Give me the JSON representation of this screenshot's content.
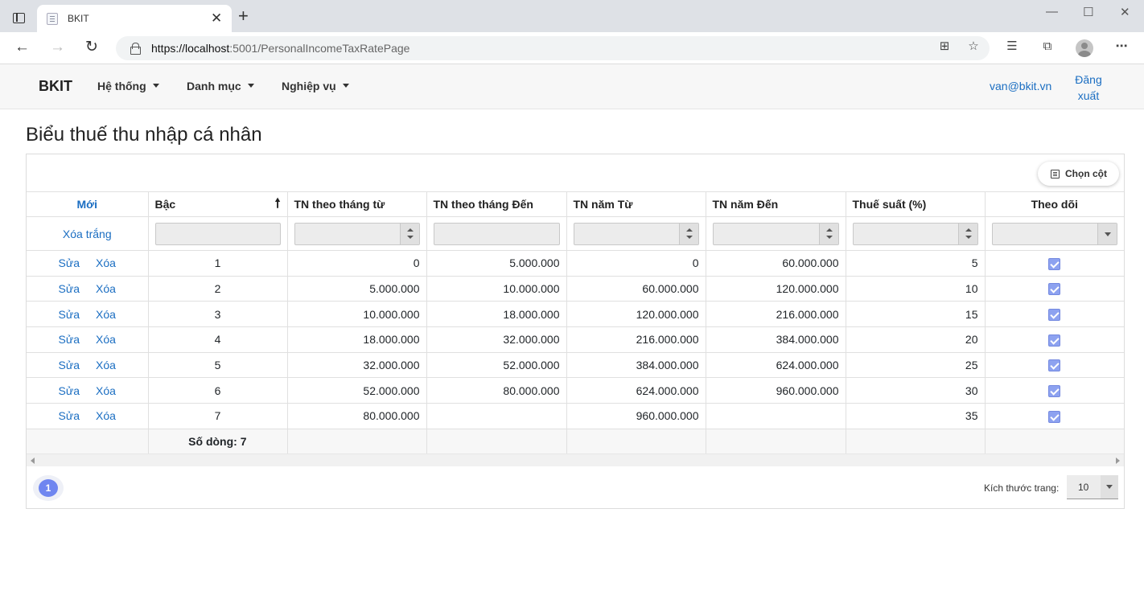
{
  "browser": {
    "tab_title": "BKIT",
    "tab_close": "✕",
    "new_tab": "+",
    "url_host": "https://localhost",
    "url_rest": ":5001/PersonalIncomeTaxRatePage",
    "window_controls": [
      "—",
      "☐",
      "✕"
    ]
  },
  "navbar": {
    "brand": "BKIT",
    "menus": [
      "Hệ thống",
      "Danh mục",
      "Nghiệp vụ"
    ],
    "user": "van@bkit.vn",
    "logout_line1": "Đăng",
    "logout_line2": "xuất"
  },
  "page": {
    "title": "Biểu thuế thu nhập cá nhân"
  },
  "grid": {
    "column_chooser": "Chọn cột",
    "new_label": "Mới",
    "clear_filter": "Xóa trắng",
    "edit_label": "Sửa",
    "delete_label": "Xóa",
    "columns": [
      "Bậc",
      "TN theo tháng từ",
      "TN theo tháng Đến",
      "TN năm Từ",
      "TN năm Đến",
      "Thuế suất (%)",
      "Theo dõi"
    ],
    "rows": [
      {
        "level": "1",
        "month_from": "0",
        "month_to": "5.000.000",
        "year_from": "0",
        "year_to": "60.000.000",
        "rate": "5",
        "tracked": true
      },
      {
        "level": "2",
        "month_from": "5.000.000",
        "month_to": "10.000.000",
        "year_from": "60.000.000",
        "year_to": "120.000.000",
        "rate": "10",
        "tracked": true
      },
      {
        "level": "3",
        "month_from": "10.000.000",
        "month_to": "18.000.000",
        "year_from": "120.000.000",
        "year_to": "216.000.000",
        "rate": "15",
        "tracked": true
      },
      {
        "level": "4",
        "month_from": "18.000.000",
        "month_to": "32.000.000",
        "year_from": "216.000.000",
        "year_to": "384.000.000",
        "rate": "20",
        "tracked": true
      },
      {
        "level": "5",
        "month_from": "32.000.000",
        "month_to": "52.000.000",
        "year_from": "384.000.000",
        "year_to": "624.000.000",
        "rate": "25",
        "tracked": true
      },
      {
        "level": "6",
        "month_from": "52.000.000",
        "month_to": "80.000.000",
        "year_from": "624.000.000",
        "year_to": "960.000.000",
        "rate": "30",
        "tracked": true
      },
      {
        "level": "7",
        "month_from": "80.000.000",
        "month_to": "",
        "year_from": "960.000.000",
        "year_to": "",
        "rate": "35",
        "tracked": true
      }
    ],
    "row_count": "Số dòng: 7",
    "current_page": "1",
    "page_size_label": "Kích thước trang:",
    "page_size": "10"
  }
}
